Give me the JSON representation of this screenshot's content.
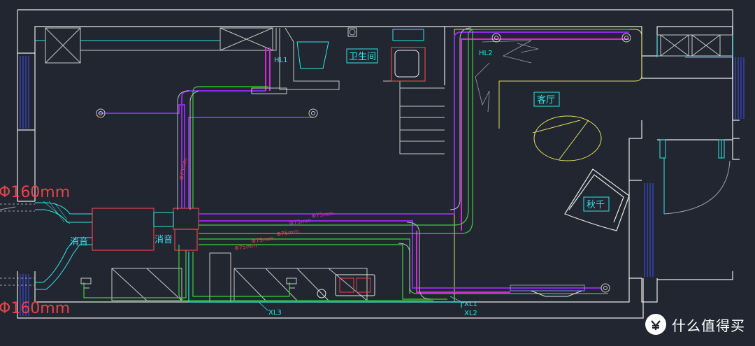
{
  "rooms": {
    "bathroom": "卫生间",
    "living_room": "客厅",
    "swing": "秋千"
  },
  "silencers": {
    "left": "消音",
    "center": "消音"
  },
  "tags": {
    "hl1": "HL1",
    "hl2": "HL2",
    "xl1": "XL1",
    "xl2": "XL2",
    "xl3": "XL3"
  },
  "duct_labels": {
    "vertical": "Φ75mm",
    "horizontal": [
      "Φ75mm",
      "Φ75mm",
      "Φ75mm",
      "Φ75mm",
      "Φ75mm"
    ]
  },
  "dimensions": {
    "top": "Φ160mm",
    "bottom": "Φ160mm"
  },
  "watermark": {
    "text": "什么值得买",
    "logo_glyph": "值"
  },
  "colors": {
    "background": "#222630",
    "wall": "#e8e8e8",
    "cyan": "#2ee6e6",
    "magenta": "#d12bd1",
    "purple": "#8a2be2",
    "green": "#3ad13a",
    "red": "#e0464a",
    "yellow": "#e0e060"
  }
}
